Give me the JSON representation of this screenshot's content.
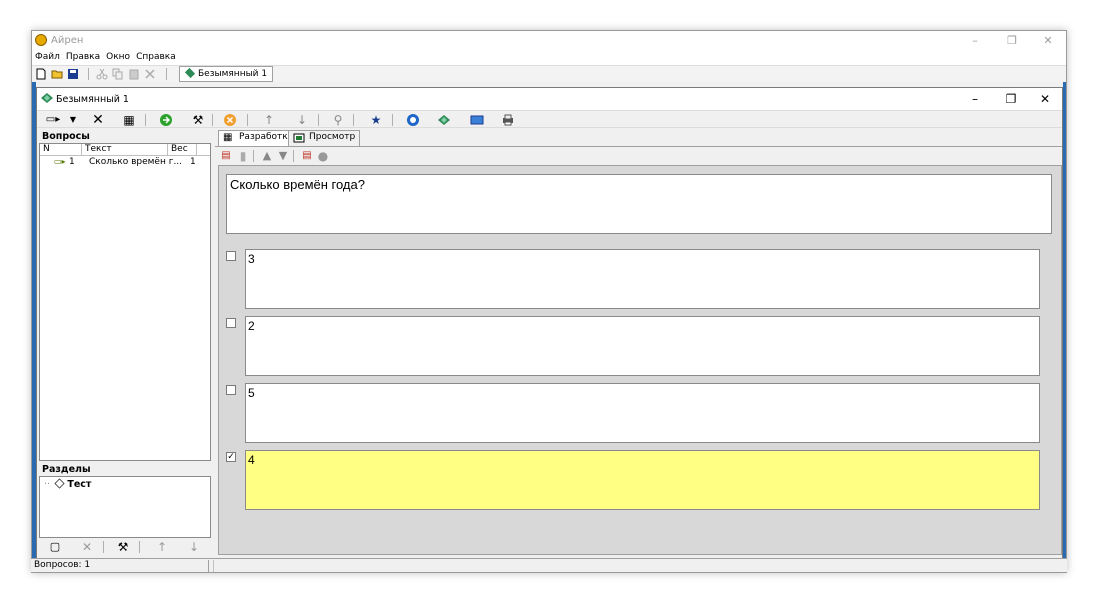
{
  "app": {
    "title": "Айрен",
    "menu": [
      "Файл",
      "Правка",
      "Окно",
      "Справка"
    ],
    "doc_tab": "Безымянный 1",
    "window_controls": [
      "–",
      "❐",
      "✕"
    ]
  },
  "document": {
    "title": "Безымянный 1",
    "window_controls": [
      "–",
      "❐",
      "✕"
    ]
  },
  "questions_panel": {
    "title": "Вопросы",
    "columns": [
      "N",
      "Текст",
      "Вес"
    ],
    "rows": [
      {
        "n": "1",
        "text": "Сколько времён г...",
        "weight": "1"
      }
    ]
  },
  "sections_panel": {
    "title": "Разделы",
    "nodes": [
      "Тест"
    ]
  },
  "tabs": [
    {
      "label": "Разработка",
      "active": true
    },
    {
      "label": "Просмотр",
      "active": false
    }
  ],
  "question": {
    "text": "Сколько времён года?"
  },
  "answers": [
    {
      "text": "3",
      "checked": false
    },
    {
      "text": "2",
      "checked": false
    },
    {
      "text": "5",
      "checked": false
    },
    {
      "text": "4",
      "checked": true
    }
  ],
  "status": {
    "questions_count": "Вопросов: 1"
  },
  "colors": {
    "correct_answer_bg": "#ffff84",
    "window_border": "#2a6ab0"
  }
}
